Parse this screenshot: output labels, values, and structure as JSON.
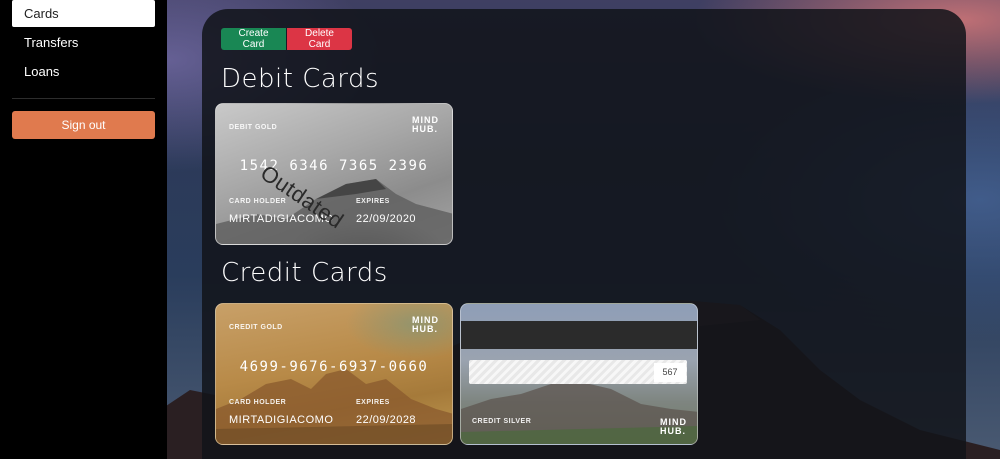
{
  "sidebar": {
    "items": [
      {
        "label": "Cards",
        "active": true
      },
      {
        "label": "Transfers",
        "active": false
      },
      {
        "label": "Loans",
        "active": false
      }
    ],
    "signout_label": "Sign out"
  },
  "toolbar": {
    "create_label": "Create Card",
    "delete_label": "Delete Card"
  },
  "sections": {
    "debit_title": "Debit Cards",
    "credit_title": "Credit Cards"
  },
  "cards": {
    "debit": {
      "type_label": "DEBIT GOLD",
      "logo_line1": "MIND",
      "logo_line2": "HUB.",
      "number": "1542 6346 7365 2396",
      "holder_label": "CARD HOLDER",
      "holder": "MIRTADIGIACOMO",
      "expires_label": "EXPIRES",
      "expires": "22/09/2020",
      "stamp": "Outdated"
    },
    "credit_gold": {
      "type_label": "CREDIT GOLD",
      "logo_line1": "MIND",
      "logo_line2": "HUB.",
      "number": "4699-9676-6937-0660",
      "holder_label": "CARD HOLDER",
      "holder": "MIRTADIGIACOMO",
      "expires_label": "EXPIRES",
      "expires": "22/09/2028"
    },
    "credit_silver": {
      "type_label": "CREDIT SILVER",
      "logo_line1": "MIND",
      "logo_line2": "HUB.",
      "cvv": "567"
    }
  },
  "colors": {
    "create": "#198754",
    "delete": "#dc3545",
    "signout": "#e07a4e"
  }
}
